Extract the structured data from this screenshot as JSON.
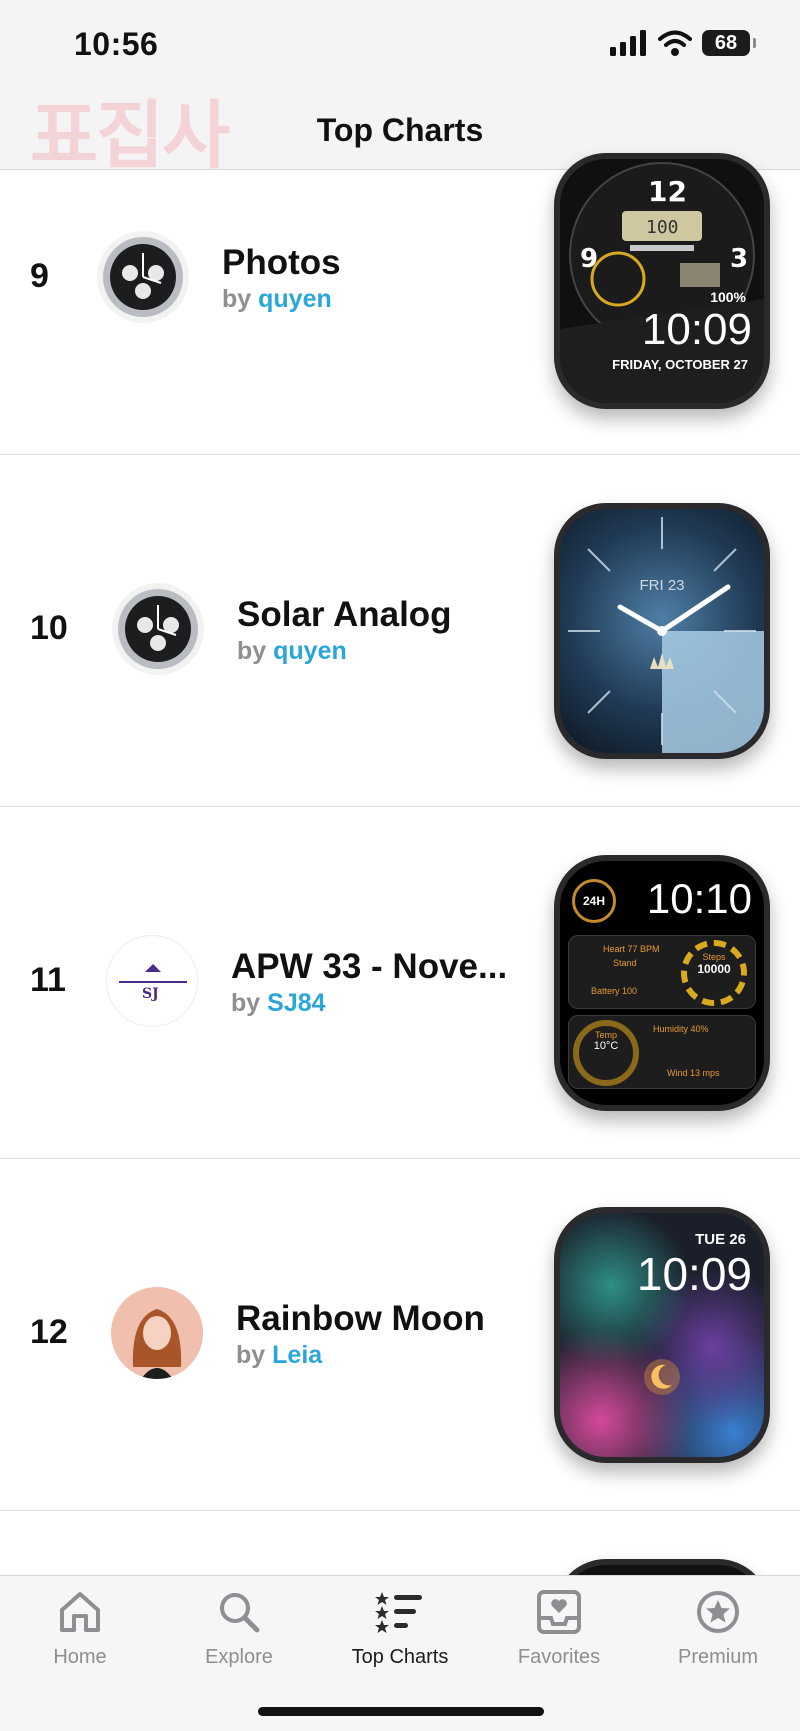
{
  "status_bar": {
    "time": "10:56",
    "battery": "68"
  },
  "header": {
    "watermark": "표집사",
    "title": "Top Charts"
  },
  "rows": [
    {
      "rank": "9",
      "title": "Photos",
      "by": "by",
      "author": "quyen",
      "avatar_icon": "chronograph-watch-avatar",
      "preview": {
        "top": "100",
        "percent": "100%",
        "time": "10:09",
        "date": "FRIDAY, OCTOBER 27"
      }
    },
    {
      "rank": "10",
      "title": "Solar Analog",
      "by": "by",
      "author": "quyen",
      "avatar_icon": "chronograph-watch-avatar",
      "preview": {
        "date": "FRI 23"
      }
    },
    {
      "rank": "11",
      "title": "APW 33 - Nove...",
      "by": "by",
      "author": "SJ84",
      "avatar_icon": "sj-logo-avatar",
      "preview": {
        "badge": "24H",
        "time": "10:10",
        "steps_label": "Steps",
        "steps": "10000",
        "heart": "Heart 77 BPM",
        "stand": "Stand",
        "battery": "Battery 100",
        "temp_label": "Temp",
        "temp": "10°C",
        "humidity": "Humidity 40%",
        "wind": "Wind 13 mps"
      }
    },
    {
      "rank": "12",
      "title": "Rainbow Moon",
      "by": "by",
      "author": "Leia",
      "avatar_icon": "girl-avatar",
      "preview": {
        "date": "TUE 26",
        "time": "10:09"
      }
    }
  ],
  "tabs": [
    {
      "label": "Home",
      "icon": "house-icon",
      "active": false
    },
    {
      "label": "Explore",
      "icon": "magnifier-icon",
      "active": false
    },
    {
      "label": "Top Charts",
      "icon": "ranked-list-icon",
      "active": true
    },
    {
      "label": "Favorites",
      "icon": "heart-inbox-icon",
      "active": false
    },
    {
      "label": "Premium",
      "icon": "star-circle-icon",
      "active": false
    }
  ],
  "colors": {
    "accent": "#2aa6d8",
    "secondary_text": "#8e8e93",
    "watermark": "#f5c9ce"
  }
}
